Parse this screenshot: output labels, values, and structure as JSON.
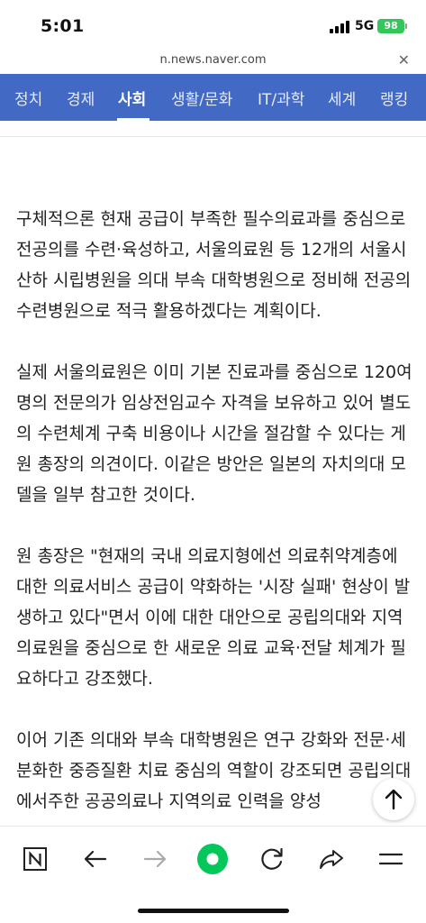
{
  "status": {
    "time": "5:01",
    "network": "5G",
    "battery": "98"
  },
  "browser": {
    "url": "n.news.naver.com",
    "close_icon": "close-icon"
  },
  "tabs": [
    {
      "label": "정치"
    },
    {
      "label": "경제"
    },
    {
      "label": "사회"
    },
    {
      "label": "생활/문화"
    },
    {
      "label": "IT/과학"
    },
    {
      "label": "세계"
    },
    {
      "label": "랭킹"
    }
  ],
  "active_tab": "사회",
  "article": {
    "paragraphs": [
      "구체적으론 현재 공급이 부족한 필수의료과를 중심으로 전공의를 수련·육성하고, 서울의료원 등 12개의 서울시 산하 시립병원을 의대 부속 대학병원으로 정비해 전공의 수련병원으로 적극 활용하겠다는 계획이다.",
      "실제 서울의료원은 이미 기본 진료과를 중심으로 120여 명의 전문의가 임상전임교수 자격을 보유하고 있어 별도의 수련체계 구축 비용이나 시간을 절감할 수 있다는 게 원 총장의 의견이다. 이같은 방안은 일본의 자치의대 모델을 일부 참고한 것이다.",
      "원 총장은 \"현재의 국내 의료지형에선 의료취약계층에 대한 의료서비스 공급이 약화하는 '시장 실패' 현상이 발생하고 있다\"면서 이에 대한 대안으로 공립의대와 지역의료원을 중심으로 한 새로운 의료 교육·전달 체계가 필요하다고 강조했다.",
      "이어 기존 의대와 부속 대학병원은 연구 강화와 전문·세분화한 중증질환 치료 중심의 역할이 강조되면 공립의대에서주한 공공의료나 지역의료 인력을 양성"
    ]
  },
  "icons": {
    "scroll_top": "arrow-up-icon",
    "naver_home": "naver-n-icon",
    "back": "back-arrow-icon",
    "forward": "forward-arrow-icon",
    "green_dot": "green-dot-icon",
    "reload": "reload-icon",
    "share": "share-icon",
    "menu": "menu-icon"
  },
  "colors": {
    "tab_bar": "#4269c4",
    "naver_green": "#03c75a",
    "battery": "#33c759"
  }
}
